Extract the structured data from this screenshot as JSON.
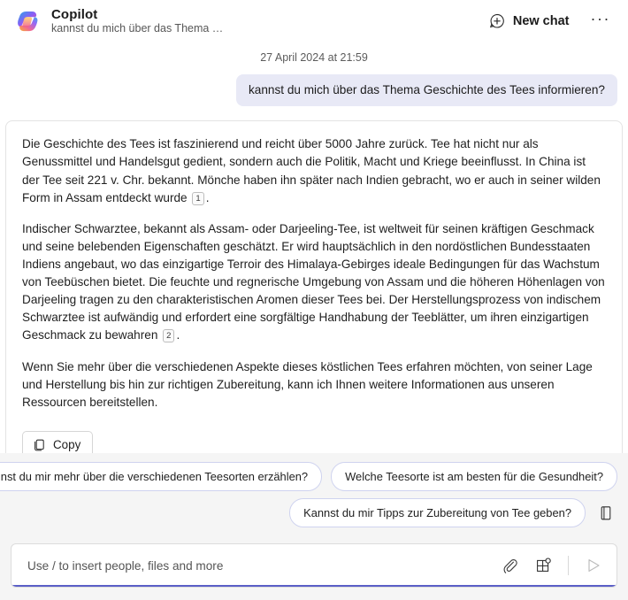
{
  "header": {
    "logo_icon": "copilot-logo-icon",
    "title": "Copilot",
    "subtitle": "kannst du mich über das Thema …",
    "new_chat_label": "New chat",
    "new_chat_icon": "new-chat-plus-bubble-icon",
    "more_options_label": "···"
  },
  "conversation": {
    "timestamp": "27 April 2024 at 21:59",
    "user_message": "kannst du mich über das Thema Geschichte des Tees informieren?",
    "response": {
      "paragraphs": [
        {
          "text_before": "Die Geschichte des Tees ist faszinierend und reicht über 5000 Jahre zurück. Tee hat nicht nur als Genussmittel und Handelsgut gedient, sondern auch die Politik, Macht und Kriege beeinflusst. In China ist der Tee seit 221 v. Chr. bekannt. Mönche haben ihn später nach Indien gebracht, wo er auch in seiner wilden Form in Assam entdeckt wurde ",
          "citation": "1",
          "text_after": "."
        },
        {
          "text_before": "Indischer Schwarztee, bekannt als Assam- oder Darjeeling-Tee, ist weltweit für seinen kräftigen Geschmack und seine belebenden Eigenschaften geschätzt. Er wird hauptsächlich in den nordöstlichen Bundesstaaten Indiens angebaut, wo das einzigartige Terroir des Himalaya-Gebirges ideale Bedingungen für das Wachstum von Teebüschen bietet. Die feuchte und regnerische Umgebung von Assam und die höheren Höhenlagen von Darjeeling tragen zu den charakteristischen Aromen dieser Tees bei. Der Herstellungsprozess von indischem Schwarztee ist aufwändig und erfordert eine sorgfältige Handhabung der Teeblätter, um ihren einzigartigen Geschmack zu bewahren ",
          "citation": "2",
          "text_after": "."
        },
        {
          "text_before": "Wenn Sie mehr über die verschiedenen Aspekte dieses köstlichen Tees erfahren möchten, von seiner Lage und Herstellung bis hin zur richtigen Zubereitung, kann ich Ihnen weitere Informationen aus unseren Ressourcen bereitstellen.",
          "citation": "",
          "text_after": ""
        }
      ],
      "copy_label": "Copy",
      "copy_icon": "copy-icon"
    }
  },
  "suggestions": {
    "row1": [
      "Kannst du mir mehr über die verschiedenen Teesorten erzählen?",
      "Welche Teesorte ist am besten für die Gesundheit?"
    ],
    "row2": [
      "Kannst du mir Tipps zur Zubereitung von Tee geben?"
    ],
    "notebook_icon": "notebook-icon"
  },
  "composer": {
    "placeholder": "Use / to insert people, files and more",
    "value": "",
    "attach_icon": "paperclip-icon",
    "apps_icon": "apps-grid-plus-icon",
    "send_icon": "send-icon"
  },
  "colors": {
    "accent": "#5b5fc7",
    "user_bubble": "#e8e9f6",
    "chip_border": "#cfd3ef",
    "page_bg": "#f5f5f5",
    "card_border": "#e3e3e3"
  }
}
